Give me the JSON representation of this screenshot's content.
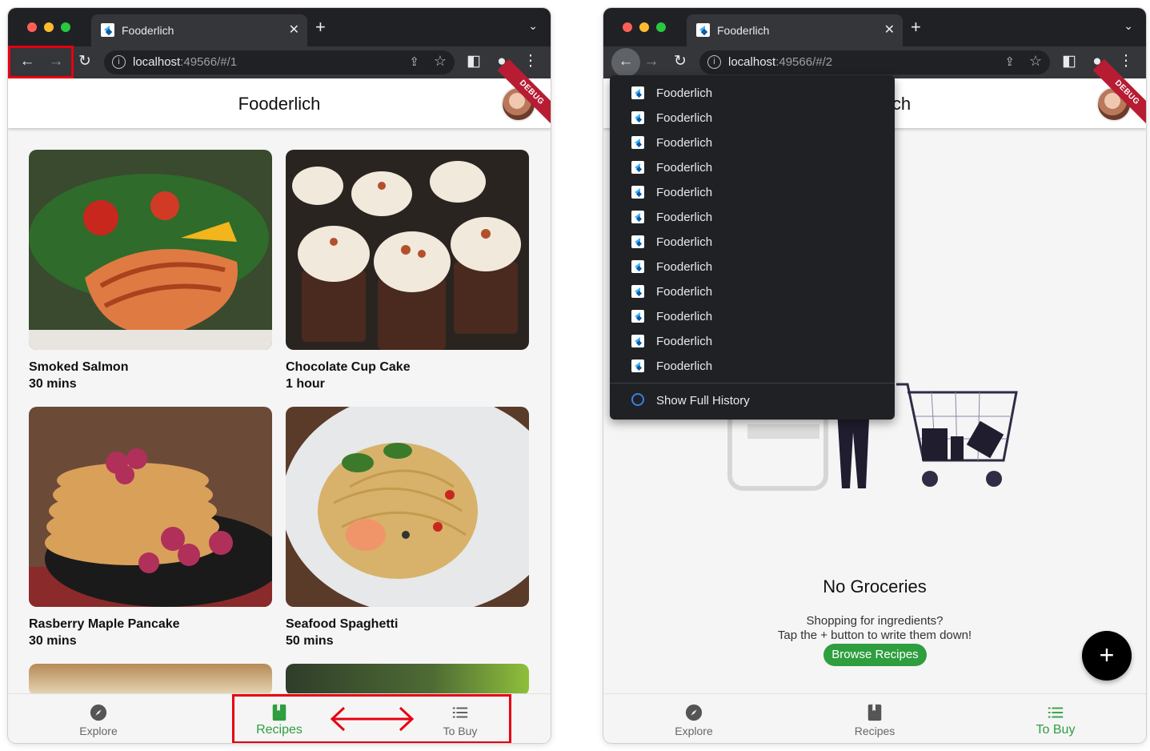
{
  "colors": {
    "accent_green": "#2e9e3f",
    "highlight_red": "#e60012",
    "chrome_dark": "#202124"
  },
  "left_window": {
    "tab_title": "Fooderlich",
    "url_host": "localhost",
    "url_path": ":49566/#/1",
    "app_title": "Fooderlich",
    "debug_badge": "DEBUG",
    "recipes": [
      {
        "name": "Smoked Salmon",
        "time": "30 mins"
      },
      {
        "name": "Chocolate Cup Cake",
        "time": "1 hour"
      },
      {
        "name": "Rasberry Maple Pancake",
        "time": "30 mins"
      },
      {
        "name": "Seafood Spaghetti",
        "time": "50 mins"
      }
    ],
    "nav": [
      {
        "label": "Explore",
        "icon": "compass-icon",
        "active": false
      },
      {
        "label": "Recipes",
        "icon": "book-icon",
        "active": true
      },
      {
        "label": "To Buy",
        "icon": "list-icon",
        "active": false
      }
    ]
  },
  "right_window": {
    "tab_title": "Fooderlich",
    "url_host": "localhost",
    "url_path": ":49566/#/2",
    "app_title_visible": "ich",
    "debug_badge": "DEBUG",
    "history_items": [
      "Fooderlich",
      "Fooderlich",
      "Fooderlich",
      "Fooderlich",
      "Fooderlich",
      "Fooderlich",
      "Fooderlich",
      "Fooderlich",
      "Fooderlich",
      "Fooderlich",
      "Fooderlich",
      "Fooderlich"
    ],
    "show_full_history": "Show Full History",
    "empty_title": "No Groceries",
    "empty_line1": "Shopping for ingredients?",
    "empty_line2": "Tap the + button to write them down!",
    "browse_button": "Browse Recipes",
    "fab_label": "+",
    "nav": [
      {
        "label": "Explore",
        "icon": "compass-icon",
        "active": false
      },
      {
        "label": "Recipes",
        "icon": "book-icon",
        "active": false
      },
      {
        "label": "To Buy",
        "icon": "list-icon",
        "active": true
      }
    ]
  }
}
